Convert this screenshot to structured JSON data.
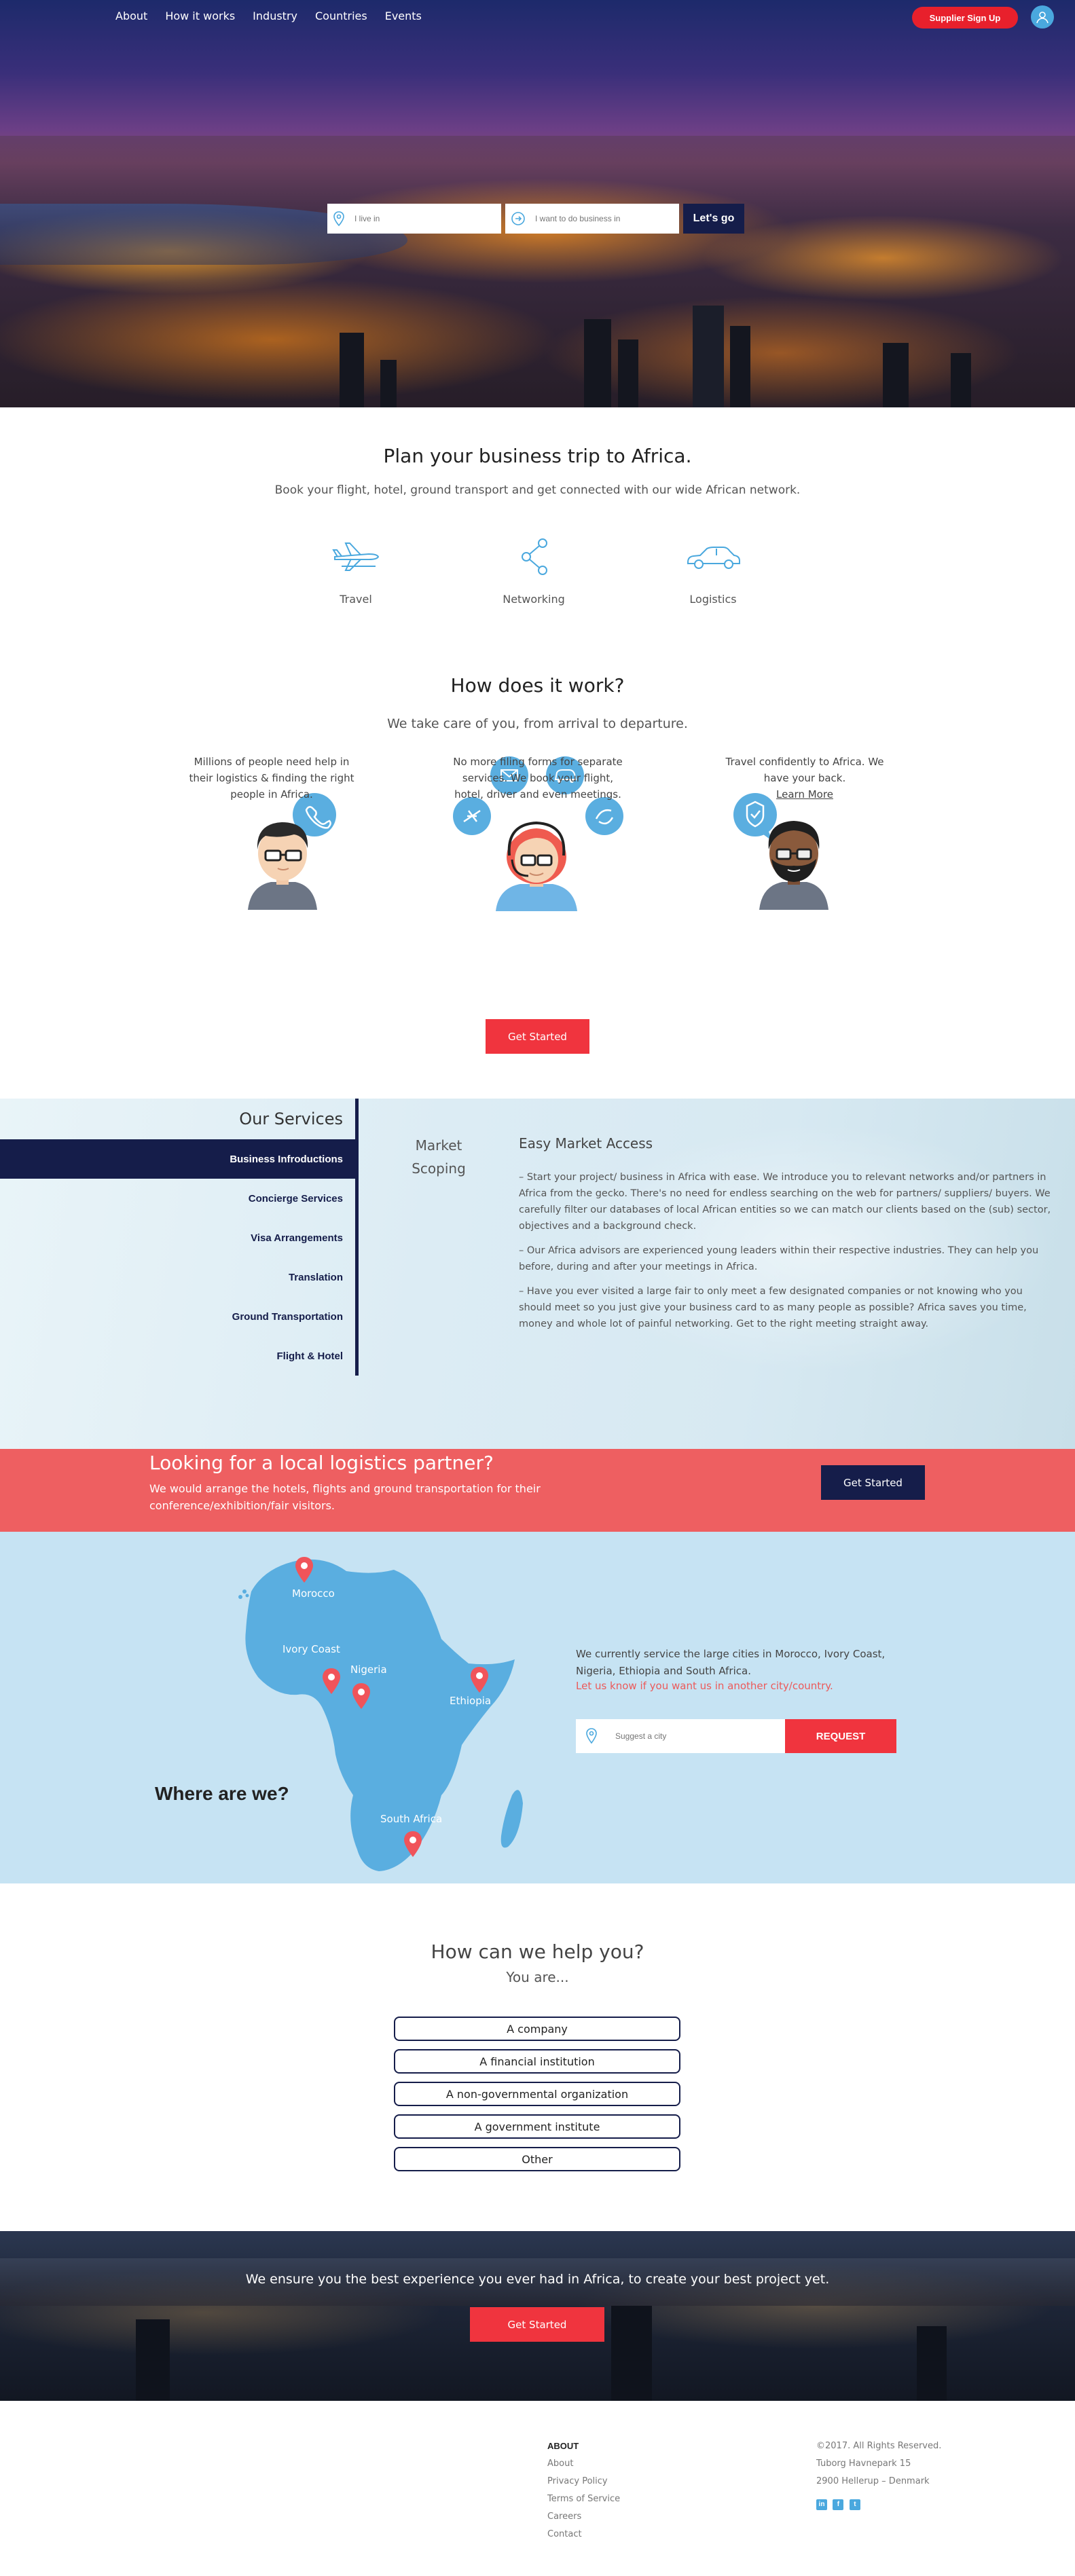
{
  "nav": {
    "items": [
      "About",
      "How it works",
      "Industry",
      "Countries",
      "Events"
    ],
    "supplier_signup": "Supplier Sign Up"
  },
  "search": {
    "live_placeholder": "I live in",
    "business_placeholder": "I want to do business in",
    "go_label": "Let's go"
  },
  "plan": {
    "title": "Plan your business trip to Africa.",
    "subtitle": "Book your flight, hotel, ground transport and get connected with our wide African network.",
    "features": [
      "Travel",
      "Networking",
      "Logistics"
    ]
  },
  "how": {
    "title": "How does it work?",
    "subtitle": "We take care of you, from arrival to departure.",
    "steps": [
      "Millions of people need help in their logistics & finding the right people in Africa.",
      "No more filing forms for separate services. We book your flight, hotel, driver and even meetings.",
      "Travel confidently to Africa. We have your back."
    ],
    "learn_more": "Learn More",
    "cta": "Get Started"
  },
  "services": {
    "heading": "Our Services",
    "items": [
      "Business Infroductions",
      "Concierge Services",
      "Visa Arrangements",
      "Translation",
      "Ground Transportation",
      "Flight & Hotel"
    ],
    "sub_tab": "Market Scoping",
    "content_title": "Easy Market Access",
    "paragraphs": [
      "– Start your project/ business in Africa with ease. We introduce you to relevant networks and/or partners in Africa from the gecko. There's no need for endless searching on the web for partners/ suppliers/ buyers. We carefully filter our databases of local African entities so we can match our clients based on the (sub) sector, objectives and a background check.",
      "– Our Africa advisors are experienced young leaders within their respective industries. They can help you before, during and after your meetings in Africa.",
      "– Have you ever visited a large fair to only meet a few designated companies or not knowing who you should meet so you just give your business card to as many people as possible? Africa saves you time, money and whole lot of painful networking. Get to the right meeting straight away."
    ]
  },
  "logistics": {
    "title": "Looking for a local logistics partner?",
    "text": "We would arrange the hotels, flights and ground transportation for their conference/exhibition/fair visitors.",
    "cta": "Get Started"
  },
  "map": {
    "heading": "Where are we?",
    "cities": [
      "Morocco",
      "Ivory Coast",
      "Nigeria",
      "Ethiopia",
      "South Africa"
    ],
    "text": "We currently service the large cities in Morocco, Ivory Coast, Nigeria, Ethiopia and South Africa.",
    "link": "Let us know if you want us in another city/country.",
    "city_placeholder": "Suggest a city",
    "request": "REQUEST",
    "colors": {
      "land": "#5aaee0",
      "pin": "#f0545a",
      "bg": "#c6e3f3"
    }
  },
  "help": {
    "title": "How can we help you?",
    "subtitle": "You are...",
    "options": [
      "A company",
      "A financial institution",
      "A non-governmental organization",
      "A government institute",
      "Other"
    ]
  },
  "bottom": {
    "text": "We ensure you the best experience you ever had in Africa, to create your best project yet.",
    "cta": "Get Started"
  },
  "footer": {
    "about_heading": "ABOUT",
    "links": [
      "About",
      "Privacy Policy",
      "Terms of Service",
      "Careers",
      "Contact"
    ],
    "info": [
      "©2017. All Rights Reserved.",
      "Tuborg Havnepark 15",
      "2900 Hellerup – Denmark"
    ],
    "social": [
      "linkedin-icon",
      "facebook-icon",
      "twitter-icon"
    ]
  },
  "colors": {
    "navy": "#151d4a",
    "red": "#f0343e",
    "coral": "#ee5f61",
    "blue": "#4aa8de"
  }
}
